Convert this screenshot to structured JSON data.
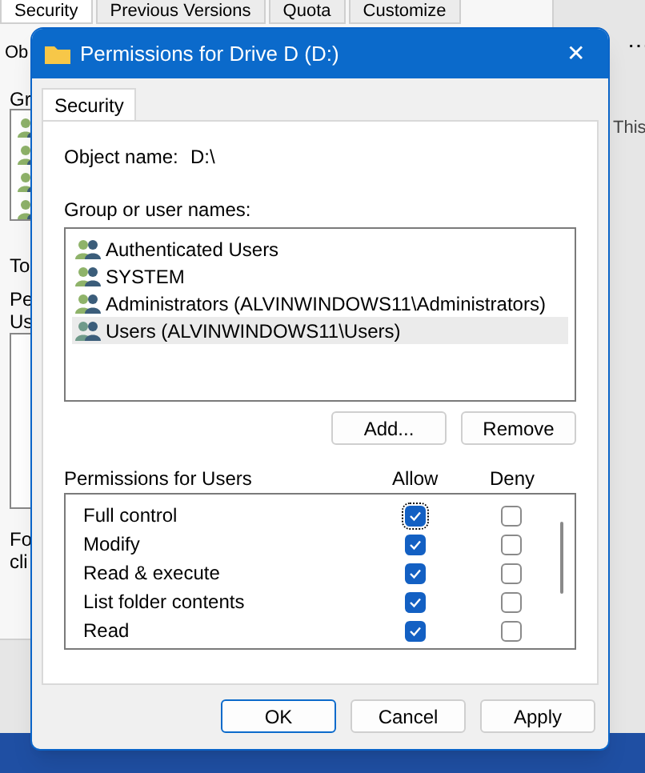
{
  "background_window": {
    "tabs": [
      {
        "label": "Security",
        "selected": true
      },
      {
        "label": "Previous Versions",
        "selected": false
      },
      {
        "label": "Quota",
        "selected": false
      },
      {
        "label": "Customize",
        "selected": false
      }
    ],
    "fragments": [
      "Ob",
      "Gr",
      "To",
      "Pe",
      "Us",
      "Fo",
      "cli"
    ],
    "side_text": "This",
    "more": "⋯"
  },
  "dialog": {
    "title": "Permissions for Drive D (D:)",
    "close": "✕",
    "tabs": [
      {
        "label": "Security",
        "selected": true
      }
    ],
    "object_label": "Object name:",
    "object_value": "D:\\",
    "group_label": "Group or user names:",
    "groups": [
      {
        "name": "Authenticated Users",
        "selected": false
      },
      {
        "name": "SYSTEM",
        "selected": false
      },
      {
        "name": "Administrators (ALVINWINDOWS11\\Administrators)",
        "selected": false
      },
      {
        "name": "Users (ALVINWINDOWS11\\Users)",
        "selected": true
      }
    ],
    "group_buttons": [
      "Add...",
      "Remove"
    ],
    "permissions_label": "Permissions for Users",
    "allow_label": "Allow",
    "deny_label": "Deny",
    "permissions": [
      {
        "name": "Full control",
        "allow": true,
        "deny": false
      },
      {
        "name": "Modify",
        "allow": true,
        "deny": false
      },
      {
        "name": "Read & execute",
        "allow": true,
        "deny": false
      },
      {
        "name": "List folder contents",
        "allow": true,
        "deny": false
      },
      {
        "name": "Read",
        "allow": true,
        "deny": false
      }
    ],
    "buttons": [
      {
        "label": "OK",
        "default": true
      },
      {
        "label": "Cancel",
        "default": false
      },
      {
        "label": "Apply",
        "default": false
      }
    ]
  }
}
